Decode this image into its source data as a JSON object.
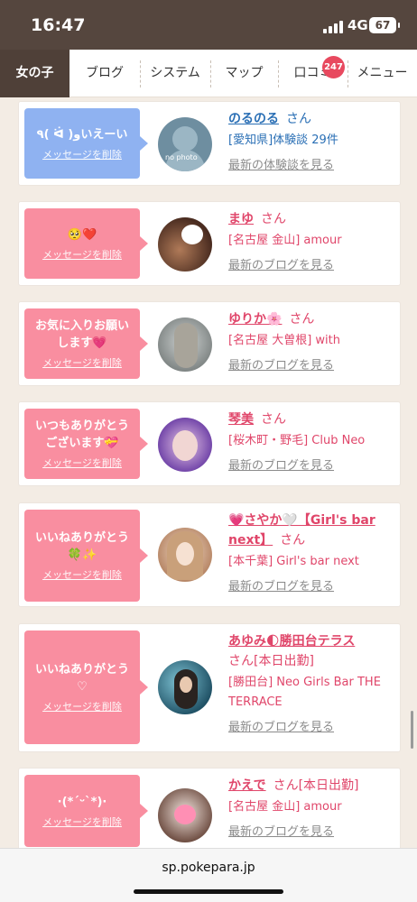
{
  "status": {
    "time": "16:47",
    "network": "4G",
    "battery": "67"
  },
  "tabs": [
    {
      "label": "女の子"
    },
    {
      "label": "ブログ"
    },
    {
      "label": "システム"
    },
    {
      "label": "マップ"
    },
    {
      "label": "口コミ"
    },
    {
      "label": "メニュー"
    }
  ],
  "reviews_badge": "247",
  "cards": [
    {
      "message": "٩( ᐛ )وいえーい",
      "delete_label": "メッセージを削除",
      "name": "のるのる",
      "honorific": "さん",
      "extra": "",
      "shop": "[愛知県]体験談 29件",
      "more": "最新の体験談を見る",
      "avatar_text": "no photo",
      "theme": "blue"
    },
    {
      "message": "🥺❤️",
      "delete_label": "メッセージを削除",
      "name": "まゆ",
      "honorific": "さん",
      "extra": "",
      "shop": "[名古屋 金山] amour",
      "more": "最新のブログを見る"
    },
    {
      "message": "お気に入りお願いします💗",
      "delete_label": "メッセージを削除",
      "name": "ゆりか🌸",
      "honorific": "さん",
      "extra": "",
      "shop": "[名古屋 大曽根] with",
      "more": "最新のブログを見る"
    },
    {
      "message": "いつもありがとうございます💝",
      "delete_label": "メッセージを削除",
      "name": "琴美",
      "honorific": "さん",
      "extra": "",
      "shop": "[桜木町・野毛] Club Neo",
      "more": "最新のブログを見る"
    },
    {
      "message": "いいねありがとう🍀✨",
      "delete_label": "メッセージを削除",
      "name": "💗さやか🤍【Girl's bar next】",
      "honorific": "さん",
      "extra": "",
      "shop": "[本千葉] Girl's bar next",
      "more": "最新のブログを見る"
    },
    {
      "message": "いいねありがとう♡",
      "delete_label": "メッセージを削除",
      "name": "あゆみ🌓勝田台テラス",
      "honorific": "さん",
      "extra": "[本日出勤]",
      "shop": "[勝田台] Neo Girls Bar THE TERRACE",
      "more": "最新のブログを見る"
    },
    {
      "message": "·(*´ᵕ`*)·",
      "delete_label": "メッセージを削除",
      "name": "かえで",
      "honorific": "さん",
      "extra": "[本日出勤]",
      "shop": "[名古屋 金山] amour",
      "more": "最新のブログを見る"
    }
  ],
  "url": "sp.pokepara.jp",
  "colors": {
    "accent": "#e0466a",
    "bubble_pink": "#f98ea0",
    "bubble_blue": "#8fb2f1",
    "nav_active": "#4f4038",
    "status_bar": "#55463e"
  }
}
